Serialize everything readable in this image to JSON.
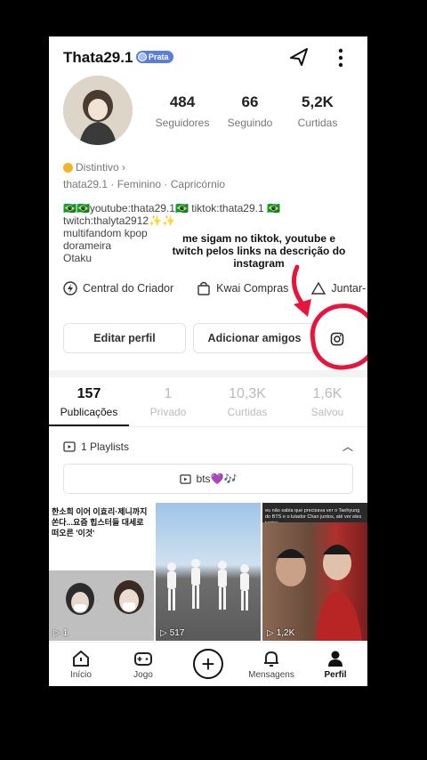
{
  "profile": {
    "username": "Thata29.1",
    "badge": "Prata",
    "stats": [
      {
        "value": "484",
        "label": "Seguidores"
      },
      {
        "value": "66",
        "label": "Seguindo"
      },
      {
        "value": "5,2K",
        "label": "Curtidas"
      }
    ],
    "distintivo": "Distintivo ›",
    "meta": "thata29.1 · Feminino · Capricórnio",
    "bio": "🇧🇷🇧🇷youtube:thata29.1🇧🇷 tiktok:thata29.1 🇧🇷\ntwitch:thalyta2912✨✨\nmultifandom kpop\ndorameira\nOtaku"
  },
  "overlay_note": "me sigam no tiktok, youtube e twitch pelos links na descrição do instagram",
  "quick_links": {
    "creator": "Central do Criador",
    "shop": "Kwai Compras",
    "join": "Juntar-"
  },
  "actions": {
    "edit": "Editar perfil",
    "add_friends": "Adicionar amigos"
  },
  "tabs": [
    {
      "value": "157",
      "label": "Publicações"
    },
    {
      "value": "1",
      "label": "Privado"
    },
    {
      "value": "10,3K",
      "label": "Curtidas"
    },
    {
      "value": "1,6K",
      "label": "Salvou"
    }
  ],
  "playlists": {
    "label": "1 Playlists",
    "item": "bts💜🎶"
  },
  "videos": [
    {
      "caption": "한소희 이어 이효리·제니까지 쏜다...요즘 힙스터들 대세로 떠오른 '이것'",
      "plays": "1"
    },
    {
      "caption": "",
      "plays": "517"
    },
    {
      "caption": "eu não sabia que precisava ver o Taehyung do BTS e o lutador Chan juntos, até ver eles juntos...",
      "plays": "1,2K"
    }
  ],
  "nav": {
    "home": "Início",
    "game": "Jogo",
    "messages": "Mensagens",
    "profile": "Perfil"
  },
  "colors": {
    "accent_red": "#e8143c",
    "badge_blue": "#5b7fd6"
  }
}
